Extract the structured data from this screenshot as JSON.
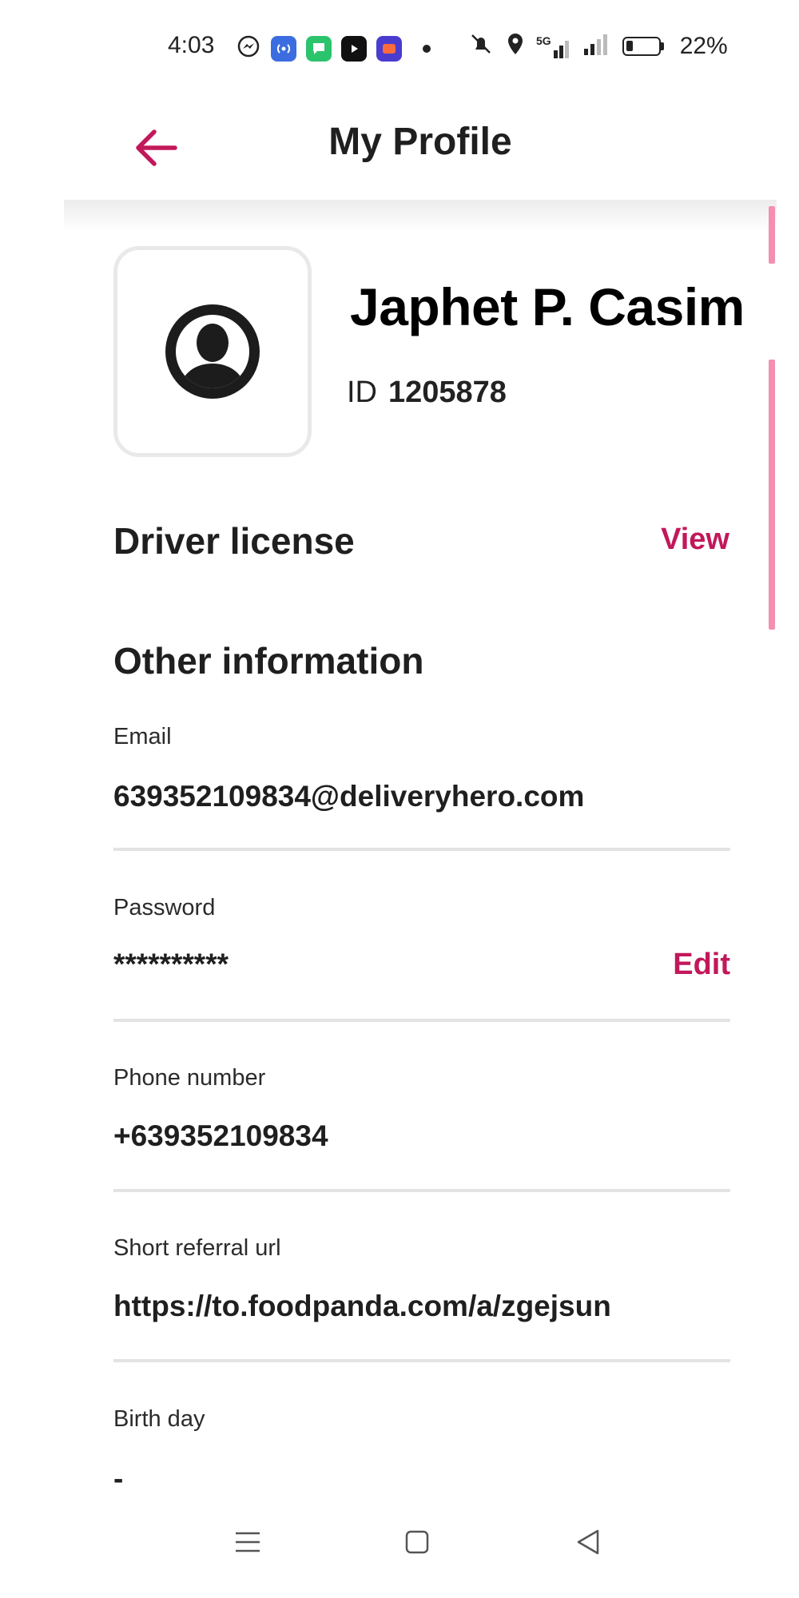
{
  "status_bar": {
    "time": "4:03",
    "network_label": "5G",
    "battery_percent_text": "22%",
    "battery_level": 0.22,
    "icons": [
      "messenger-icon",
      "broadcast-icon",
      "chat-app-icon",
      "youtube-icon",
      "lazada-icon",
      "mute-icon",
      "location-icon",
      "signal-icon"
    ]
  },
  "header": {
    "title": "My Profile",
    "back_icon": "arrow-left-icon"
  },
  "profile": {
    "name": "Japhet P. Casim",
    "id_label": "ID",
    "id_value": "1205878"
  },
  "driver_license": {
    "title": "Driver license",
    "action_label": "View"
  },
  "other_information": {
    "title": "Other information",
    "fields": [
      {
        "label": "Email",
        "value": "639352109834@deliveryhero.com"
      },
      {
        "label": "Password",
        "value": "**********",
        "action_label": "Edit"
      },
      {
        "label": "Phone number",
        "value": "+639352109834"
      },
      {
        "label": "Short referral url",
        "value": "https://to.foodpanda.com/a/zgejsun"
      },
      {
        "label": "Birth day",
        "value": "-"
      }
    ]
  },
  "colors": {
    "accent": "#c2185b",
    "scroll_indicator": "#f48fb1",
    "divider": "#e3e3e3"
  }
}
